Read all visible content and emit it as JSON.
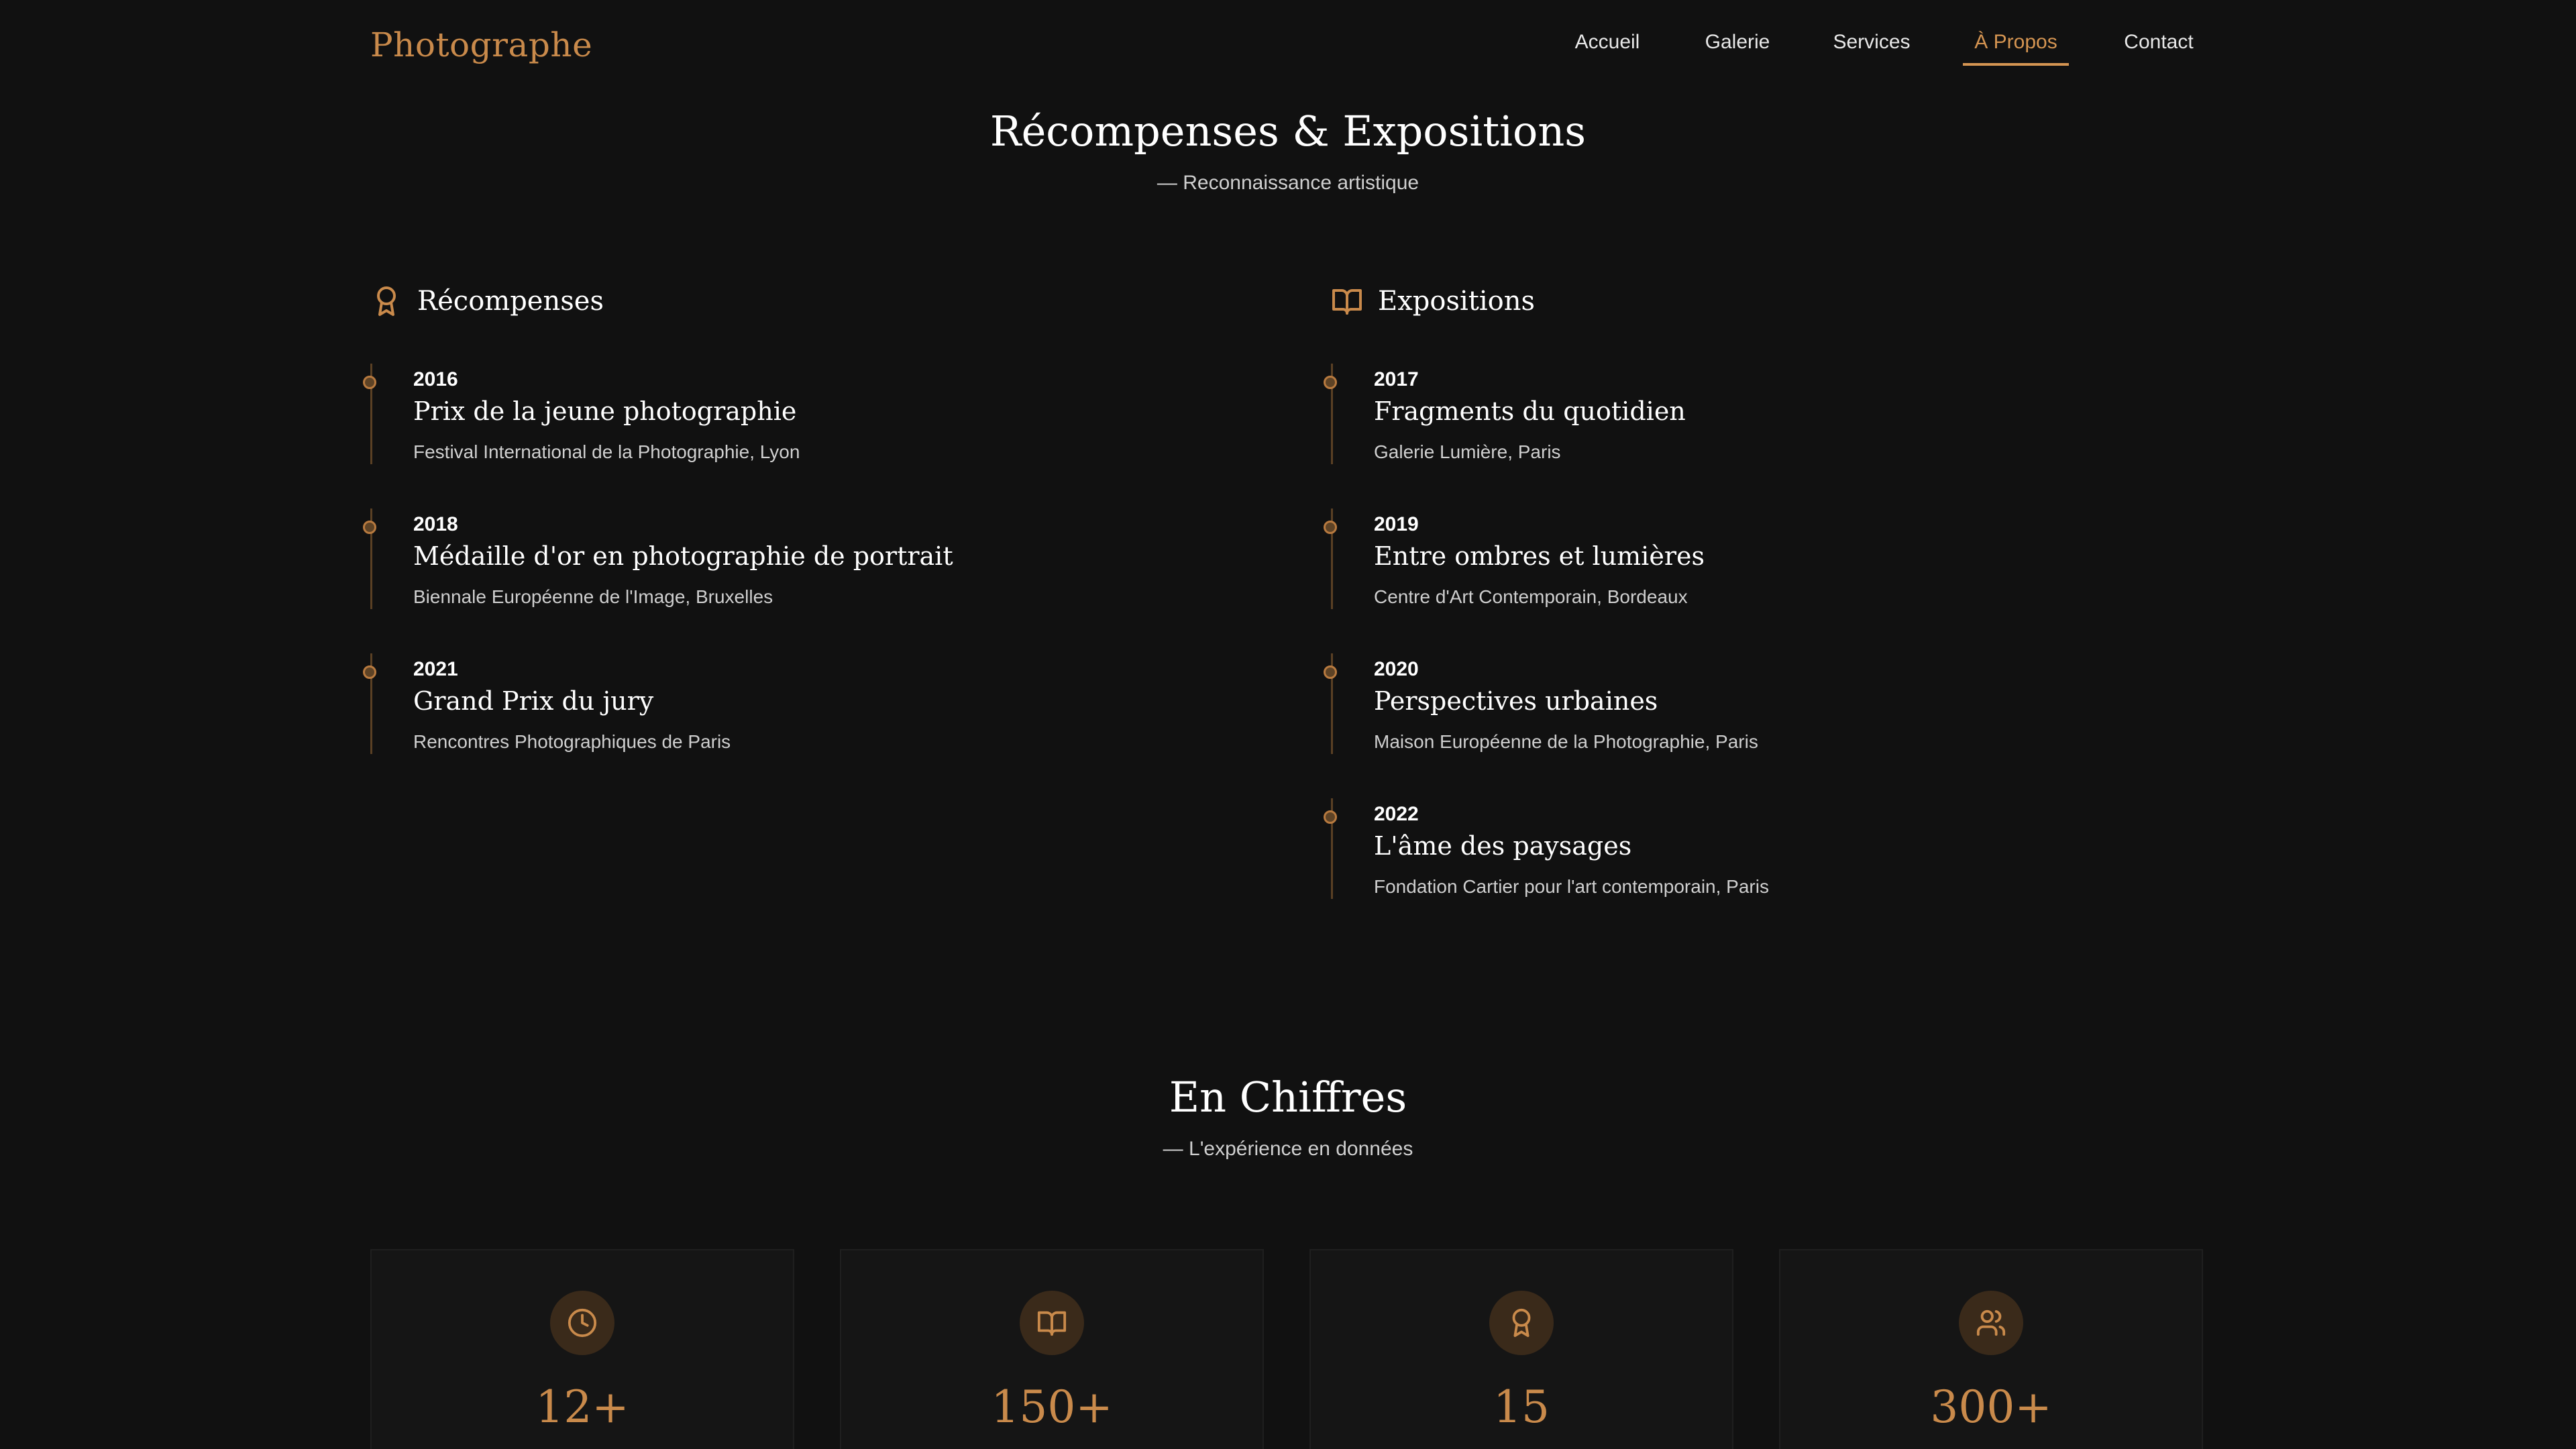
{
  "brand": "Photographe",
  "nav": {
    "items": [
      {
        "label": "Accueil",
        "active": false
      },
      {
        "label": "Galerie",
        "active": false
      },
      {
        "label": "Services",
        "active": false
      },
      {
        "label": "À Propos",
        "active": true
      },
      {
        "label": "Contact",
        "active": false
      }
    ]
  },
  "awards_section": {
    "title": "Récompenses & Expositions",
    "subtitle": "— Reconnaissance artistique",
    "awards": {
      "title": "Récompenses",
      "icon": "award-icon",
      "items": [
        {
          "year": "2016",
          "title": "Prix de la jeune photographie",
          "place": "Festival International de la Photographie, Lyon"
        },
        {
          "year": "2018",
          "title": "Médaille d'or en photographie de portrait",
          "place": "Biennale Européenne de l'Image, Bruxelles"
        },
        {
          "year": "2021",
          "title": "Grand Prix du jury",
          "place": "Rencontres Photographiques de Paris"
        }
      ]
    },
    "exhibitions": {
      "title": "Expositions",
      "icon": "book-open-icon",
      "items": [
        {
          "year": "2017",
          "title": "Fragments du quotidien",
          "place": "Galerie Lumière, Paris"
        },
        {
          "year": "2019",
          "title": "Entre ombres et lumières",
          "place": "Centre d'Art Contemporain, Bordeaux"
        },
        {
          "year": "2020",
          "title": "Perspectives urbaines",
          "place": "Maison Européenne de la Photographie, Paris"
        },
        {
          "year": "2022",
          "title": "L'âme des paysages",
          "place": "Fondation Cartier pour l'art contemporain, Paris"
        }
      ]
    }
  },
  "stats_section": {
    "title": "En Chiffres",
    "subtitle": "— L'expérience en données",
    "stats": [
      {
        "icon": "clock-icon",
        "value": "12+"
      },
      {
        "icon": "book-open-icon",
        "value": "150+"
      },
      {
        "icon": "award-icon",
        "value": "15"
      },
      {
        "icon": "users-icon",
        "value": "300+"
      }
    ]
  },
  "colors": {
    "background": "#111111",
    "accent": "#c98a4b",
    "card": "#151515"
  }
}
